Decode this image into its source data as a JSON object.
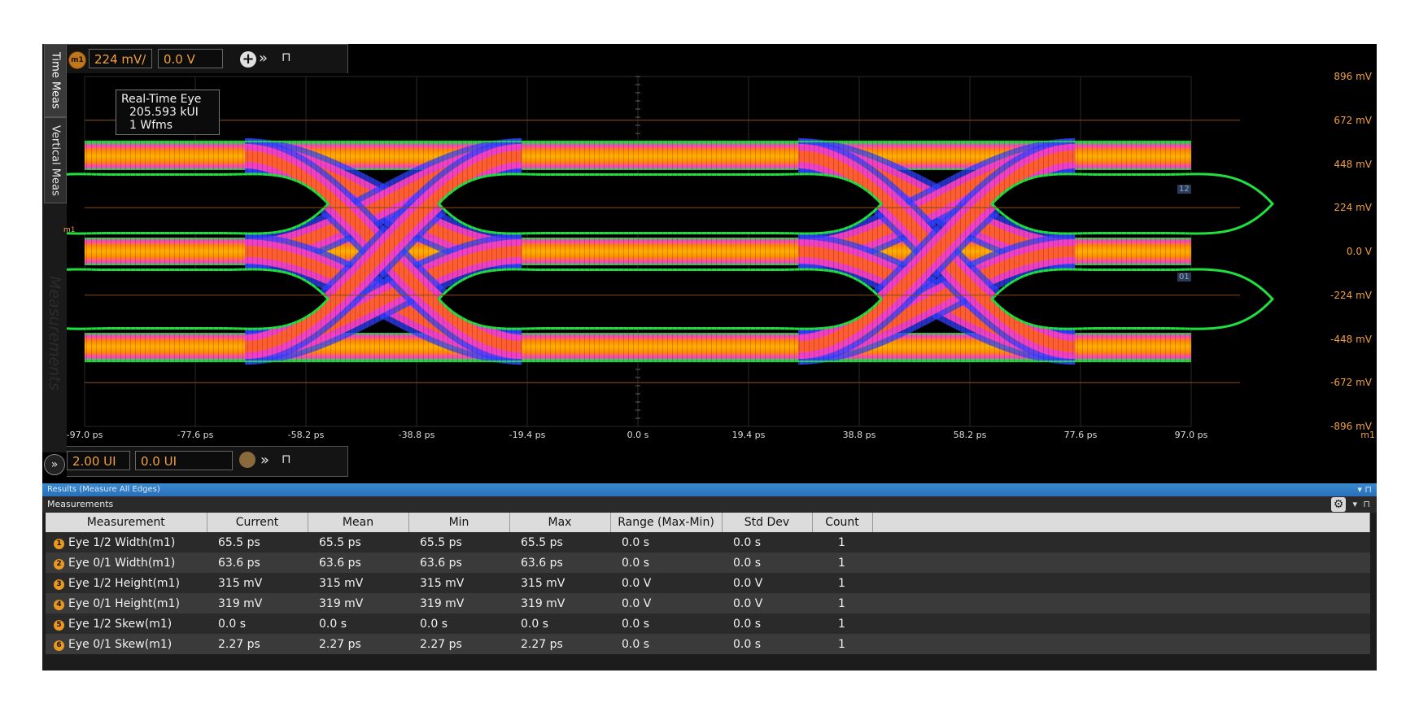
{
  "side_tabs": {
    "time_meas": "Time Meas",
    "vertical_meas": "Vertical Meas",
    "measurements": "Measurements"
  },
  "vertical_toolbar": {
    "marker_label": "m1",
    "scale_value": "224 mV/",
    "offset_value": "0.0 V"
  },
  "horizontal_toolbar": {
    "scale_value": "2.00 UI",
    "offset_value": "0.0 UI"
  },
  "tooltip": {
    "title": "Real-Time Eye",
    "unit_intervals": "205.593 kUI",
    "waveforms": "1 Wfms"
  },
  "plot": {
    "y_axis_labels": [
      "896 mV",
      "672 mV",
      "448 mV",
      "224 mV",
      "0.0 V",
      "-224 mV",
      "-448 mV",
      "-672 mV",
      "-896 mV"
    ],
    "x_axis_labels": [
      "-97.0 ps",
      "-77.6 ps",
      "-58.2 ps",
      "-38.8 ps",
      "-19.4 ps",
      "0.0 s",
      "19.4 ps",
      "38.8 ps",
      "58.2 ps",
      "77.6 ps",
      "97.0 ps"
    ],
    "x_axis_marker": "m1",
    "ground_marker": "m1",
    "threshold_tags": [
      "12",
      "01"
    ],
    "colors": {
      "axis_label": "#f0a040",
      "hot": "#ffb000",
      "warm": "#ff40c0",
      "cool": "#3040ff",
      "edge": "#20e040"
    }
  },
  "results": {
    "panel_title": "Results  (Measure All Edges)",
    "section_title": "Measurements",
    "columns": [
      "Measurement",
      "Current",
      "Mean",
      "Min",
      "Max",
      "Range (Max-Min)",
      "Std Dev",
      "Count"
    ],
    "rows": [
      {
        "num": "1",
        "name": "Eye 1/2 Width(m1)",
        "current": "65.5 ps",
        "mean": "65.5 ps",
        "min": "65.5 ps",
        "max": "65.5 ps",
        "range": "0.0 s",
        "std": "0.0 s",
        "count": "1"
      },
      {
        "num": "2",
        "name": "Eye 0/1 Width(m1)",
        "current": "63.6 ps",
        "mean": "63.6 ps",
        "min": "63.6 ps",
        "max": "63.6 ps",
        "range": "0.0 s",
        "std": "0.0 s",
        "count": "1"
      },
      {
        "num": "3",
        "name": "Eye 1/2 Height(m1)",
        "current": "315 mV",
        "mean": "315 mV",
        "min": "315 mV",
        "max": "315 mV",
        "range": "0.0 V",
        "std": "0.0 V",
        "count": "1"
      },
      {
        "num": "4",
        "name": "Eye 0/1 Height(m1)",
        "current": "319 mV",
        "mean": "319 mV",
        "min": "319 mV",
        "max": "319 mV",
        "range": "0.0 V",
        "std": "0.0 V",
        "count": "1"
      },
      {
        "num": "5",
        "name": "Eye 1/2 Skew(m1)",
        "current": "0.0 s",
        "mean": "0.0 s",
        "min": "0.0 s",
        "max": "0.0 s",
        "range": "0.0 s",
        "std": "0.0 s",
        "count": "1"
      },
      {
        "num": "6",
        "name": "Eye 0/1 Skew(m1)",
        "current": "2.27 ps",
        "mean": "2.27 ps",
        "min": "2.27 ps",
        "max": "2.27 ps",
        "range": "0.0 s",
        "std": "0.0 s",
        "count": "1"
      }
    ]
  }
}
